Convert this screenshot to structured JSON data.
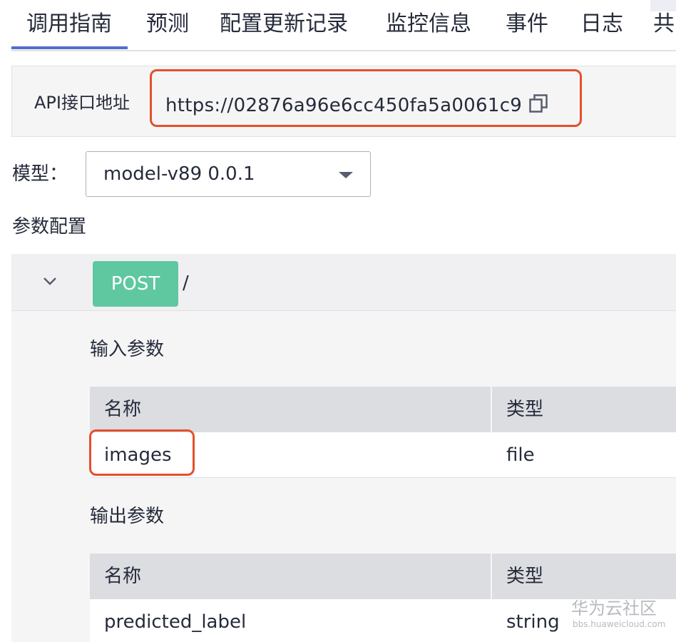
{
  "tabs": [
    {
      "label": "调用指南",
      "active": true
    },
    {
      "label": "预测"
    },
    {
      "label": "配置更新记录"
    },
    {
      "label": "监控信息"
    },
    {
      "label": "事件"
    },
    {
      "label": "日志"
    },
    {
      "label": "共"
    }
  ],
  "api": {
    "label": "API接口地址",
    "url": "https://02876a96e6cc450fa5a0061c9",
    "copy_icon": "copy-icon"
  },
  "model": {
    "label": "模型：",
    "selected": "model-v89 0.0.1"
  },
  "params": {
    "title": "参数配置",
    "method": "POST",
    "path": "/",
    "input": {
      "title": "输入参数",
      "columns": [
        "名称",
        "类型"
      ],
      "rows": [
        [
          "images",
          "file"
        ]
      ]
    },
    "output": {
      "title": "输出参数",
      "columns": [
        "名称",
        "类型"
      ],
      "rows": [
        [
          "predicted_label",
          "string"
        ]
      ]
    }
  },
  "watermark": {
    "title": "华为云社区",
    "url": "bbs.huaweicloud.com"
  },
  "colors": {
    "accent": "#526ecc",
    "highlight": "#e4502d",
    "post_badge": "#5fc8a1"
  }
}
